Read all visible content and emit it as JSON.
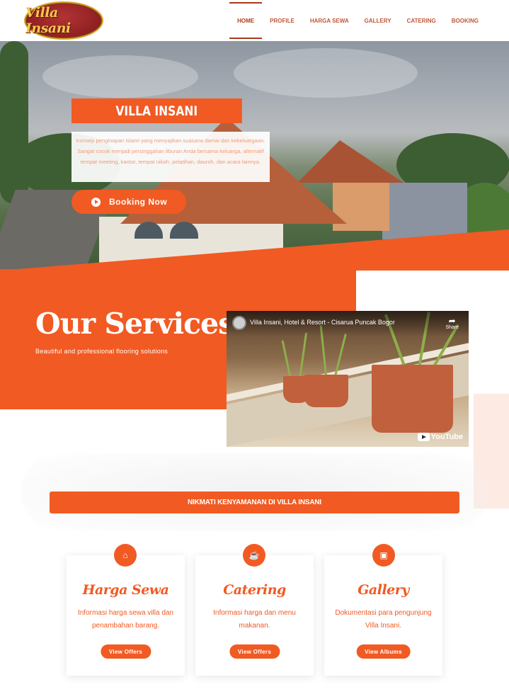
{
  "brand": {
    "logo_text": "Villa Insani"
  },
  "nav": {
    "items": [
      {
        "label": "HOME",
        "active": true
      },
      {
        "label": "PROFILE"
      },
      {
        "label": "HARGA SEWA"
      },
      {
        "label": "GALLERY"
      },
      {
        "label": "CATERING"
      },
      {
        "label": "BOOKING"
      }
    ]
  },
  "hero": {
    "title": "VILLA INSANI",
    "description": "Konsep penginapan Islami yang menyajikan suasana damai dan kekeluargaan. Sangat cocok menjadi persinggahan liburan Anda bersama keluarga, alternatif tempat meeting, kantor, tempat nikah, pelatihan, dauroh, dan acara lainnya.",
    "button_label": "Booking Now"
  },
  "services": {
    "title": "Our Services",
    "subtitle": "Beautiful and professional flooring solutions"
  },
  "video": {
    "title": "Villa Insani, Hotel & Resort - Cisarua Puncak Bogor",
    "share_label": "Share",
    "brand_label": "YouTube"
  },
  "banner": {
    "label": "NIKMATI KENYAMANAN DI VILLA INSANI"
  },
  "cards": [
    {
      "icon": "home-icon",
      "title": "Harga Sewa",
      "description": "Informasi harga sewa villa dan penambahan barang.",
      "button_label": "View Offers"
    },
    {
      "icon": "coffee-icon",
      "title": "Catering",
      "description": "Informasi harga dan menu makanan.",
      "button_label": "View Offers"
    },
    {
      "icon": "images-icon",
      "title": "Gallery",
      "description": "Dokumentasi para pengunjung Villa Insani.",
      "button_label": "View Albums"
    }
  ],
  "colors": {
    "accent": "#f15a22",
    "nav_text": "#c0573a",
    "logo_bg": "#8e1f22",
    "logo_text": "#f6c94a"
  }
}
